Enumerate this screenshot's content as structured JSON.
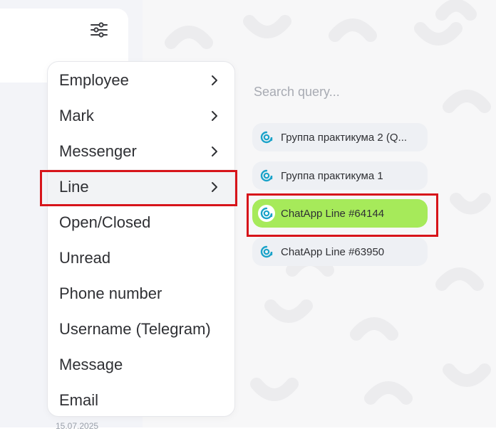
{
  "menu": {
    "items": [
      {
        "label": "Employee",
        "has_submenu": true
      },
      {
        "label": "Mark",
        "has_submenu": true
      },
      {
        "label": "Messenger",
        "has_submenu": true
      },
      {
        "label": "Line",
        "has_submenu": true
      },
      {
        "label": "Open/Closed",
        "has_submenu": false
      },
      {
        "label": "Unread",
        "has_submenu": false
      },
      {
        "label": "Phone number",
        "has_submenu": false
      },
      {
        "label": "Username (Telegram)",
        "has_submenu": false
      },
      {
        "label": "Message",
        "has_submenu": false
      },
      {
        "label": "Email",
        "has_submenu": false
      }
    ],
    "active_item": "Line"
  },
  "lines_panel": {
    "search_placeholder": "Search query...",
    "lines": [
      {
        "name": "Группа практикума 2 (Q...",
        "selected": false
      },
      {
        "name": "Группа практикума 1",
        "selected": false
      },
      {
        "name": "ChatApp Line #64144",
        "selected": true
      },
      {
        "name": "ChatApp Line #63950",
        "selected": false
      }
    ]
  },
  "background": {
    "cut_off_date": "15.07.2025"
  },
  "icons": {
    "filter": "sliders-icon",
    "chevron": "chevron-right-icon",
    "line_logo": "chatapp-logo-icon"
  },
  "colors": {
    "highlight_red": "#d7141a",
    "selected_chip": "#a6ea5a",
    "logo_teal": "#1aa3c9"
  }
}
